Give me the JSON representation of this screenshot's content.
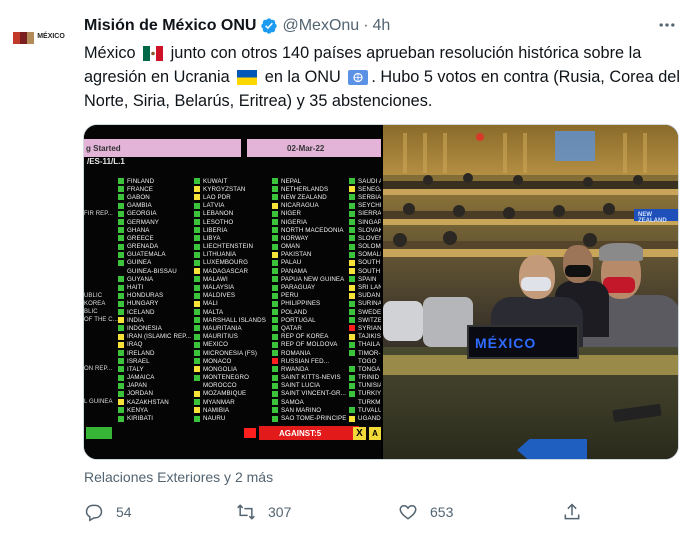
{
  "tweet": {
    "account_name": "Misión de México ONU",
    "handle": "@MexOnu",
    "separator": "·",
    "time": "4h",
    "avatar_logo_text": "MÉXICO",
    "text_part1": "México",
    "text_part2": "junto con otros 140 países aprueban resolución histórica sobre la agresión en Ucrania",
    "text_part3": "en la ONU",
    "text_part4": ". Hubo 5 votos en contra (Rusia, Corea del Norte, Siria, Belarús, Eritrea) y 35 abstenciones.",
    "context": "Relaciones Exteriores y 2 más",
    "replies": "54",
    "retweets": "307",
    "likes": "653",
    "icons": {
      "more": "more-horizontal-icon",
      "verified": "verified-badge-icon",
      "reply": "reply-icon",
      "retweet": "retweet-icon",
      "like": "like-icon",
      "share": "share-icon",
      "flag_mx": "mexico-flag-icon",
      "flag_ua": "ukraine-flag-icon",
      "flag_un": "united-nations-flag-icon"
    },
    "colors": {
      "verified": "#1d9bf0",
      "secondary_text": "#536471"
    }
  },
  "media": {
    "board": {
      "header_left": "g Started",
      "header_date": "02-Mar-22",
      "resolution": "/ES-11/L.1",
      "edge_rows": [
        "",
        "",
        "",
        "FIR REP...",
        "",
        "",
        "",
        "",
        "",
        "",
        "",
        "",
        "",
        "UBLIC",
        "KOREA",
        "BLIC",
        "OF THE C...",
        "",
        "",
        "",
        "",
        "",
        "ON REP...",
        "",
        "",
        "",
        "L GUINEA"
      ],
      "col1": [
        [
          "y",
          "FINLAND"
        ],
        [
          "y",
          "FRANCE"
        ],
        [
          "y",
          "GABON"
        ],
        [
          "y",
          "GAMBIA"
        ],
        [
          "y",
          "GEORGIA"
        ],
        [
          "y",
          "GERMANY"
        ],
        [
          "y",
          "GHANA"
        ],
        [
          "y",
          "GREECE"
        ],
        [
          "y",
          "GRENADA"
        ],
        [
          "y",
          "GUATEMALA"
        ],
        [
          "y",
          "GUINEA"
        ],
        [
          "e",
          "GUINEA-BISSAU"
        ],
        [
          "y",
          "GUYANA"
        ],
        [
          "y",
          "HAITI"
        ],
        [
          "y",
          "HONDURAS"
        ],
        [
          "y",
          "HUNGARY"
        ],
        [
          "y",
          "ICELAND"
        ],
        [
          "a",
          "INDIA"
        ],
        [
          "y",
          "INDONESIA"
        ],
        [
          "a",
          "IRAN (ISLAMIC REP..."
        ],
        [
          "a",
          "IRAQ"
        ],
        [
          "y",
          "IRELAND"
        ],
        [
          "y",
          "ISRAEL"
        ],
        [
          "y",
          "ITALY"
        ],
        [
          "y",
          "JAMAICA"
        ],
        [
          "y",
          "JAPAN"
        ],
        [
          "y",
          "JORDAN"
        ],
        [
          "a",
          "KAZAKHSTAN"
        ],
        [
          "y",
          "KENYA"
        ],
        [
          "y",
          "KIRIBATI"
        ]
      ],
      "col2": [
        [
          "y",
          "KUWAIT"
        ],
        [
          "a",
          "KYRGYZSTAN"
        ],
        [
          "a",
          "LAO PDR"
        ],
        [
          "y",
          "LATVIA"
        ],
        [
          "y",
          "LEBANON"
        ],
        [
          "y",
          "LESOTHO"
        ],
        [
          "y",
          "LIBERIA"
        ],
        [
          "y",
          "LIBYA"
        ],
        [
          "y",
          "LIECHTENSTEIN"
        ],
        [
          "y",
          "LITHUANIA"
        ],
        [
          "y",
          "LUXEMBOURG"
        ],
        [
          "a",
          "MADAGASCAR"
        ],
        [
          "y",
          "MALAWI"
        ],
        [
          "y",
          "MALAYSIA"
        ],
        [
          "y",
          "MALDIVES"
        ],
        [
          "a",
          "MALI"
        ],
        [
          "y",
          "MALTA"
        ],
        [
          "y",
          "MARSHALL ISLANDS"
        ],
        [
          "y",
          "MAURITANIA"
        ],
        [
          "y",
          "MAURITIUS"
        ],
        [
          "y",
          "MEXICO"
        ],
        [
          "y",
          "MICRONESIA (FS)"
        ],
        [
          "y",
          "MONACO"
        ],
        [
          "a",
          "MONGOLIA"
        ],
        [
          "y",
          "MONTENEGRO"
        ],
        [
          "e",
          "MOROCCO"
        ],
        [
          "a",
          "MOZAMBIQUE"
        ],
        [
          "y",
          "MYANMAR"
        ],
        [
          "a",
          "NAMIBIA"
        ],
        [
          "y",
          "NAURU"
        ]
      ],
      "col3": [
        [
          "y",
          "NEPAL"
        ],
        [
          "y",
          "NETHERLANDS"
        ],
        [
          "y",
          "NEW ZEALAND"
        ],
        [
          "a",
          "NICARAGUA"
        ],
        [
          "y",
          "NIGER"
        ],
        [
          "y",
          "NIGERIA"
        ],
        [
          "y",
          "NORTH MACEDONIA"
        ],
        [
          "y",
          "NORWAY"
        ],
        [
          "y",
          "OMAN"
        ],
        [
          "a",
          "PAKISTAN"
        ],
        [
          "y",
          "PALAU"
        ],
        [
          "y",
          "PANAMA"
        ],
        [
          "y",
          "PAPUA NEW GUINEA"
        ],
        [
          "y",
          "PARAGUAY"
        ],
        [
          "y",
          "PERU"
        ],
        [
          "y",
          "PHILIPPINES"
        ],
        [
          "y",
          "POLAND"
        ],
        [
          "y",
          "PORTUGAL"
        ],
        [
          "y",
          "QATAR"
        ],
        [
          "y",
          "REP OF KOREA"
        ],
        [
          "y",
          "REP OF MOLDOVA"
        ],
        [
          "y",
          "ROMANIA"
        ],
        [
          "n",
          "RUSSIAN FED..."
        ],
        [
          "y",
          "RWANDA"
        ],
        [
          "y",
          "SAINT KITTS-NEVIS"
        ],
        [
          "y",
          "SAINT LUCIA"
        ],
        [
          "y",
          "SAINT VINCENT-GR..."
        ],
        [
          "y",
          "SAMOA"
        ],
        [
          "y",
          "SAN MARINO"
        ],
        [
          "y",
          "SAO TOME-PRINCIPE"
        ]
      ],
      "col4": [
        [
          "y",
          "SAUDI A"
        ],
        [
          "a",
          "SENEGA"
        ],
        [
          "y",
          "SERBIA"
        ],
        [
          "y",
          "SEYCHE"
        ],
        [
          "y",
          "SIERRA"
        ],
        [
          "y",
          "SINGAP"
        ],
        [
          "y",
          "SLOVAK"
        ],
        [
          "y",
          "SLOVEN"
        ],
        [
          "y",
          "SOLOM"
        ],
        [
          "y",
          "SOMALI"
        ],
        [
          "a",
          "SOUTH"
        ],
        [
          "a",
          "SOUTH"
        ],
        [
          "y",
          "SPAIN"
        ],
        [
          "a",
          "SRI LAN"
        ],
        [
          "a",
          "SUDAN"
        ],
        [
          "y",
          "SURINA"
        ],
        [
          "y",
          "SWEDEN"
        ],
        [
          "y",
          "SWITZE"
        ],
        [
          "n",
          "SYRIAN"
        ],
        [
          "a",
          "TAJIKIS"
        ],
        [
          "y",
          "THAILA"
        ],
        [
          "y",
          "TIMOR-"
        ],
        [
          "e",
          "TOGO"
        ],
        [
          "y",
          "TONGA"
        ],
        [
          "y",
          "TRINID"
        ],
        [
          "y",
          "TUNISIA"
        ],
        [
          "y",
          "TURKIY"
        ],
        [
          "e",
          "TURKME"
        ],
        [
          "y",
          "TUVALU"
        ],
        [
          "a",
          "UGAND"
        ]
      ],
      "against_label": "AGAINST:5",
      "abstain_mark": "X",
      "abstain_next": "A"
    },
    "photo": {
      "plaque_text": "MÉXICO",
      "nameplate_text": "NEW ZEALAND"
    }
  }
}
